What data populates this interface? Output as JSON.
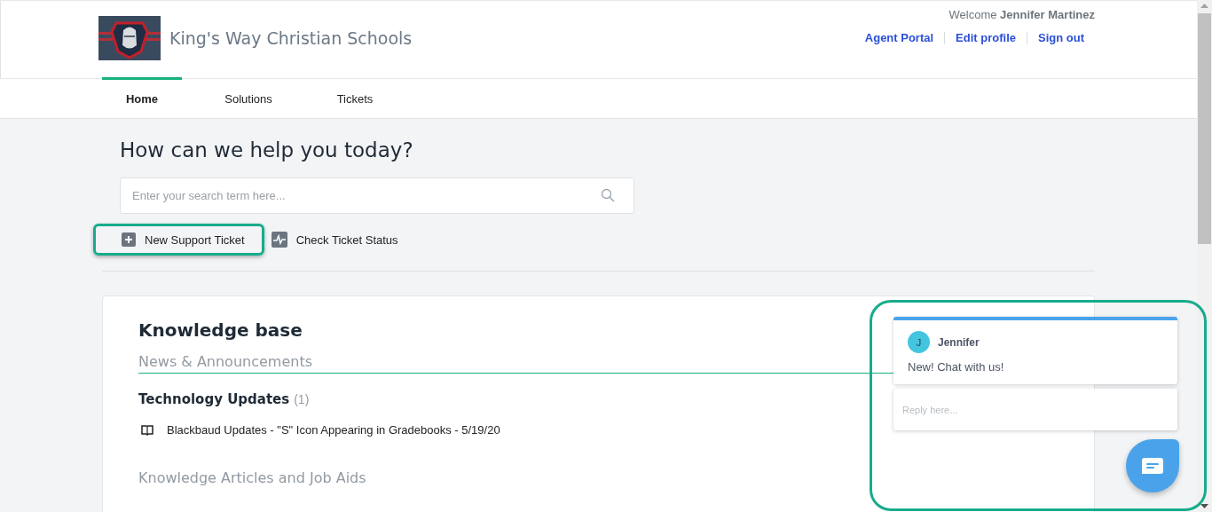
{
  "header": {
    "school_name": "King's Way Christian Schools",
    "welcome": "Welcome **Jennifer Martinez**",
    "links": [
      "Agent Portal",
      "Edit profile",
      "Sign out"
    ]
  },
  "tabs": [
    {
      "label": "Home",
      "selected": true
    },
    {
      "label": "Solutions",
      "selected": false
    },
    {
      "label": "Tickets",
      "selected": false
    }
  ],
  "hero": {
    "title": "How can we help you today?",
    "search": {
      "placeholder": "Enter your search term here..."
    },
    "actions": [
      {
        "label": "New Support Ticket",
        "kind": "plus",
        "highlighted": true
      },
      {
        "label": "Check Ticket Status",
        "kind": "pulse",
        "highlighted": false
      }
    ]
  },
  "knowledge_base": {
    "title": "Knowledge base",
    "sections": [
      {
        "title": "News & Announcements",
        "folders": [
          {
            "title": "Technology Updates",
            "count": "(1)",
            "articles": [
              "Blackbaud Updates - \"S\" Icon Appearing in Gradebooks - 5/19/20"
            ]
          }
        ]
      },
      {
        "title": "Knowledge Articles and Job Aids"
      }
    ]
  },
  "chat": {
    "highlighted": true,
    "agent_initial": "J",
    "agent_name": "Jennifer",
    "message": "New! Chat with us!",
    "reply_placeholder": "Reply here..."
  }
}
